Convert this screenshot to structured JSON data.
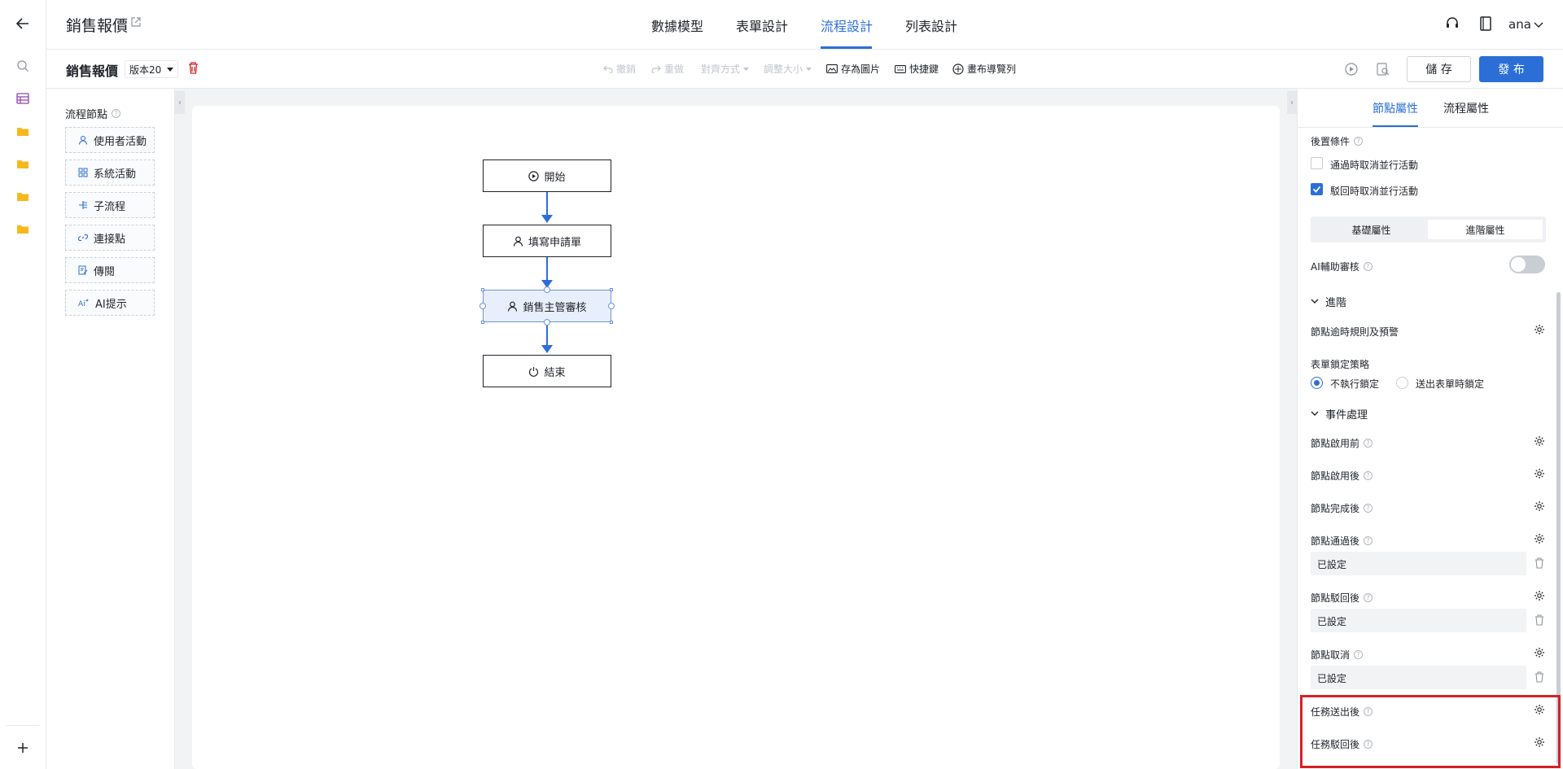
{
  "app": {
    "title": "銷售報價"
  },
  "nav": {
    "tabs": [
      "數據模型",
      "表單設計",
      "流程設計",
      "列表設計"
    ],
    "active": "流程設計"
  },
  "user": {
    "name": "ana"
  },
  "toolbar": {
    "doc_title": "銷售報價",
    "version": "版本20",
    "undo": "撤銷",
    "redo": "重做",
    "align": "對齊方式",
    "resize": "調整大小",
    "save_image": "存為圖片",
    "shortcuts": "快捷鍵",
    "canvas_nav": "畫布導覽列",
    "save": "儲 存",
    "publish": "發 布"
  },
  "palette": {
    "title": "流程節點",
    "items": [
      "使用者活動",
      "系統活動",
      "子流程",
      "連接點",
      "傳閱",
      "AI提示"
    ]
  },
  "flow": {
    "nodes": [
      {
        "label": "開始",
        "icon": "play-circle-icon"
      },
      {
        "label": "填寫申請單",
        "icon": "user-icon"
      },
      {
        "label": "銷售主管審核",
        "icon": "user-icon",
        "selected": true
      },
      {
        "label": "結束",
        "icon": "power-icon"
      }
    ]
  },
  "panel": {
    "tabs": [
      "節點屬性",
      "流程屬性"
    ],
    "active_tab": "節點屬性",
    "post_condition": "後置條件",
    "cancel_on_pass": "通過時取消並行活動",
    "cancel_on_pass_checked": false,
    "cancel_on_reject": "駁回時取消並行活動",
    "cancel_on_reject_checked": true,
    "seg_basic": "基礎屬性",
    "seg_advanced": "進階屬性",
    "ai_review": "AI輔助審核",
    "ai_review_on": false,
    "advanced_section": "進階",
    "timeout_rule": "節點逾時規則及預警",
    "lock_policy": "表單鎖定策略",
    "lock_opt1": "不執行鎖定",
    "lock_opt2": "送出表單時鎖定",
    "lock_selected": "不執行鎖定",
    "events_section": "事件處理",
    "before_start": "節點啟用前",
    "after_start": "節點啟用後",
    "after_complete": "節點完成後",
    "after_pass": "節點通過後",
    "after_pass_value": "已設定",
    "after_reject": "節點駁回後",
    "after_reject_value": "已設定",
    "node_cancel": "節點取消",
    "node_cancel_value": "已設定",
    "task_after_submit": "任務送出後",
    "task_after_reject": "任務駁回後",
    "highlight_color": "#d62026"
  }
}
